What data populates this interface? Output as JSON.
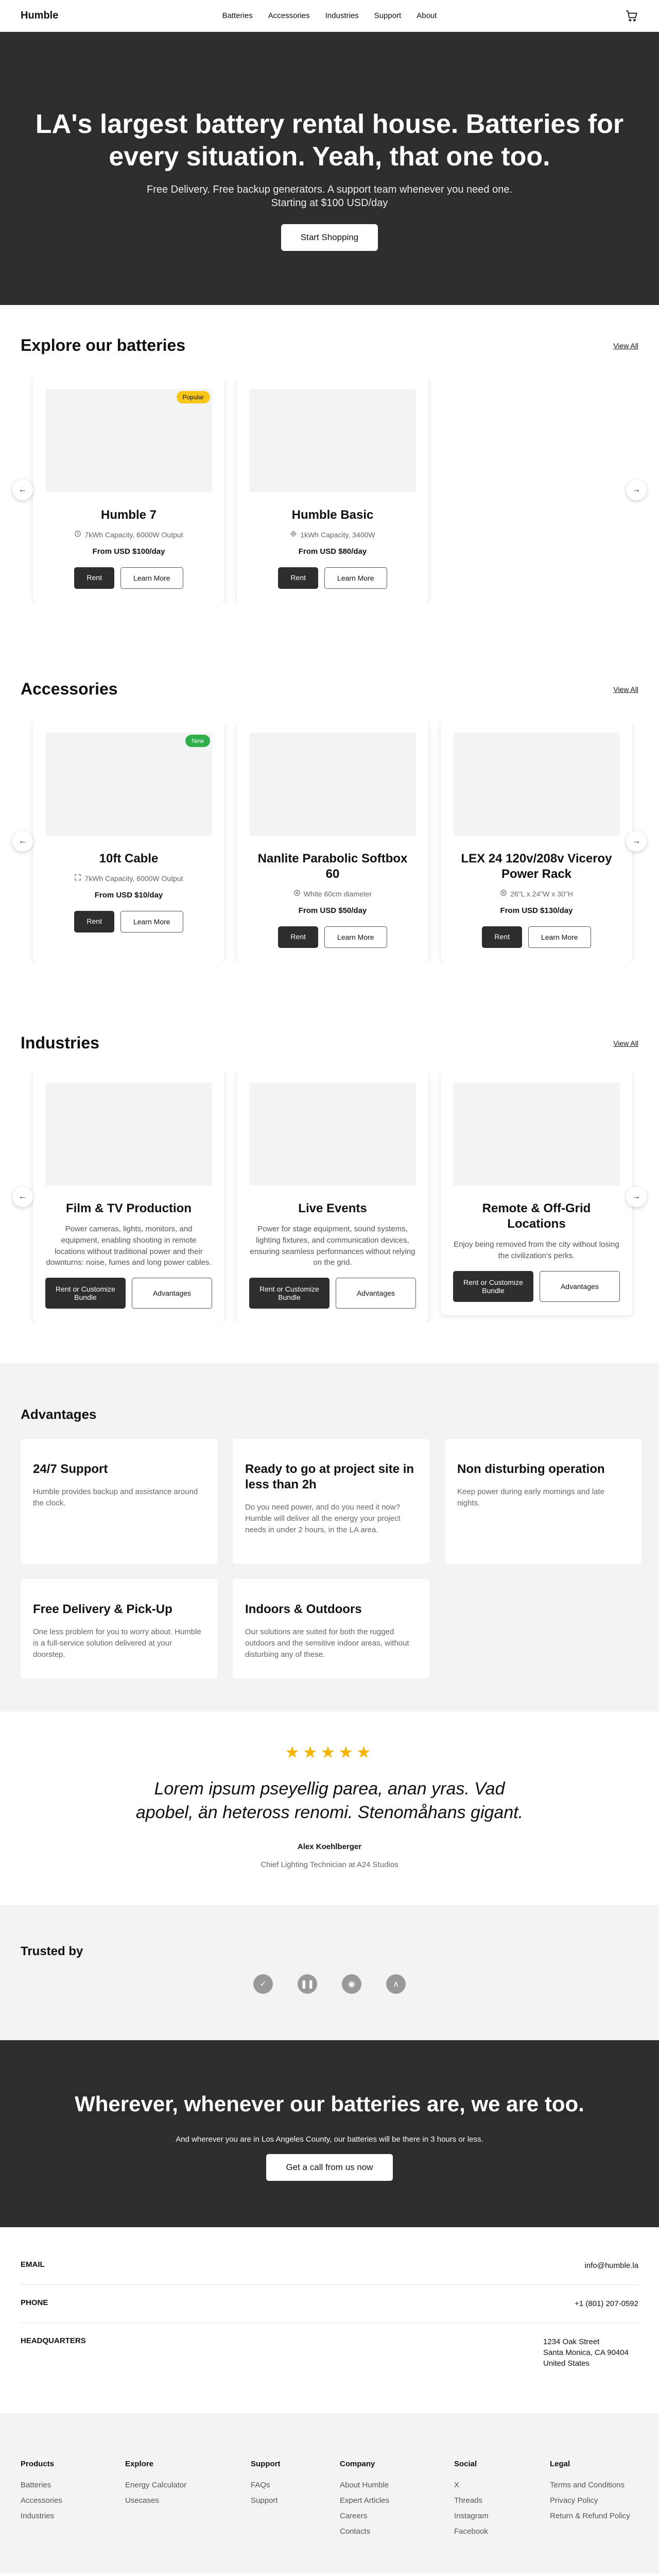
{
  "nav": {
    "logo": "Humble",
    "links": [
      "Batteries",
      "Accessories",
      "Industries",
      "Support",
      "About"
    ],
    "cart_icon": "cart-icon"
  },
  "hero": {
    "title": "LA's largest battery rental house. Batteries for every situation. Yeah, that one too.",
    "subtitle_1": "Free Delivery. Free backup generators. A support team whenever you need one.",
    "subtitle_2": "Starting at $100 USD/day",
    "cta": "Start Shopping"
  },
  "batteries": {
    "heading": "Explore our batteries",
    "view_all": "View All",
    "items": [
      {
        "badge": "Popular",
        "badge_color": "#f5c518",
        "name": "Humble 7",
        "spec": "7kWh Capacity, 6000W Output",
        "spec_icon": "clock-icon",
        "price": "From USD $100/day",
        "rent": "Rent",
        "learn": "Learn More"
      },
      {
        "name": "Humble Basic",
        "spec": "1kWh Capacity, 3400W",
        "spec_icon": "sun-icon",
        "price": "From USD $80/day",
        "rent": "Rent",
        "learn": "Learn More"
      }
    ]
  },
  "accessories": {
    "heading": "Accessories",
    "view_all": "View All",
    "items": [
      {
        "badge": "New",
        "badge_color": "#2fae4a",
        "name": "10ft Cable",
        "spec": "7kWh Capacity, 6000W Output",
        "spec_icon": "expand-icon",
        "price": "From USD $10/day",
        "rent": "Rent",
        "learn": "Learn More"
      },
      {
        "name": "Nanlite Parabolic Softbox 60",
        "spec": "White 60cm diameter",
        "spec_icon": "target-icon",
        "price": "From USD $50/day",
        "rent": "Rent",
        "learn": "Learn More"
      },
      {
        "name": "LEX 24 120v/208v Viceroy Power Rack",
        "spec": "26\"L x 24\"W x 30\"H",
        "spec_icon": "target-icon",
        "price": "From USD $130/day",
        "rent": "Rent",
        "learn": "Learn More"
      }
    ]
  },
  "industries": {
    "heading": "Industries",
    "view_all": "View All",
    "items": [
      {
        "name": "Film & TV Production",
        "desc": "Power cameras, lights, monitors, and equipment, enabling shooting in remote locations without traditional power and their downturns: noise, fumes and long power cables.",
        "primary": "Rent or Customize Bundle",
        "secondary": "Advantages"
      },
      {
        "name": "Live Events",
        "desc": "Power for stage equipment, sound systems, lighting fixtures, and communication devices, ensuring seamless performances without relying on the grid.",
        "primary": "Rent or Customize Bundle",
        "secondary": "Advantages"
      },
      {
        "name": "Remote & Off-Grid Locations",
        "desc": "Enjoy being removed from the city without losing the civilization's perks.",
        "primary": "Rent or Customize Bundle",
        "secondary": "Advantages"
      }
    ]
  },
  "advantages": {
    "heading": "Advantages",
    "items": [
      {
        "title": "24/7 Support",
        "text": "Humble provides backup and assistance around the clock."
      },
      {
        "title": "Ready to go at project site in less than 2h",
        "text": "Do you need power, and do you need it now? Humble will deliver all the energy your project needs in under 2 hours, in the LA area."
      },
      {
        "title": "Non disturbing operation",
        "text": "Keep power during early mornings and late nights."
      },
      {
        "title": "Free Delivery & Pick-Up",
        "text": "One less problem for you to worry about. Humble is a full-service solution delivered at your doorstep."
      },
      {
        "title": "Indoors & Outdoors",
        "text": "Our solutions are suited for both the rugged outdoors and the sensitive indoor areas, without disturbing any of these."
      }
    ]
  },
  "testimonial": {
    "stars": "★★★★★",
    "rating": 5,
    "quote": "Lorem ipsum pseyellig parea, anan yras. Vad apobel, än heteross renomi. Stenomåhans gigant.",
    "author": "Alex Koehlberger",
    "role": "Chief Lighting Technician at A24 Studios"
  },
  "trusted": {
    "heading": "Trusted by",
    "logos": [
      "✓",
      "❚❚",
      "◉",
      "∧"
    ]
  },
  "band": {
    "title": "Wherever, whenever our batteries are, we are too.",
    "text": "And wherever you are in Los Angeles County, our batteries will be there in 3 hours or less.",
    "cta": "Get a call from us now"
  },
  "contact": {
    "email_label": "EMAIL",
    "email": "info@humble.la",
    "phone_label": "PHONE",
    "phone": "+1 (801) 207-0592",
    "hq_label": "HEADQUARTERS",
    "hq_lines": [
      "1234 Oak Street",
      "Santa Monica, CA 90404",
      "United States"
    ]
  },
  "footer": {
    "columns": [
      {
        "title": "Products",
        "items": [
          "Batteries",
          "Accessories",
          "Industries"
        ]
      },
      {
        "title": "Explore",
        "items": [
          "Energy Calculator",
          "Usecases"
        ]
      },
      {
        "title": "Support",
        "items": [
          "FAQs",
          "Support"
        ]
      },
      {
        "title": "Company",
        "items": [
          "About Humble",
          "Expert Articles",
          "Careers",
          "Contacts"
        ]
      },
      {
        "title": "Social",
        "items": [
          "X",
          "Threads",
          "Instagram",
          "Facebook"
        ]
      },
      {
        "title": "Legal",
        "items": [
          "Terms and Conditions",
          "Privacy Policy",
          "Return & Refund Policy"
        ]
      }
    ]
  }
}
